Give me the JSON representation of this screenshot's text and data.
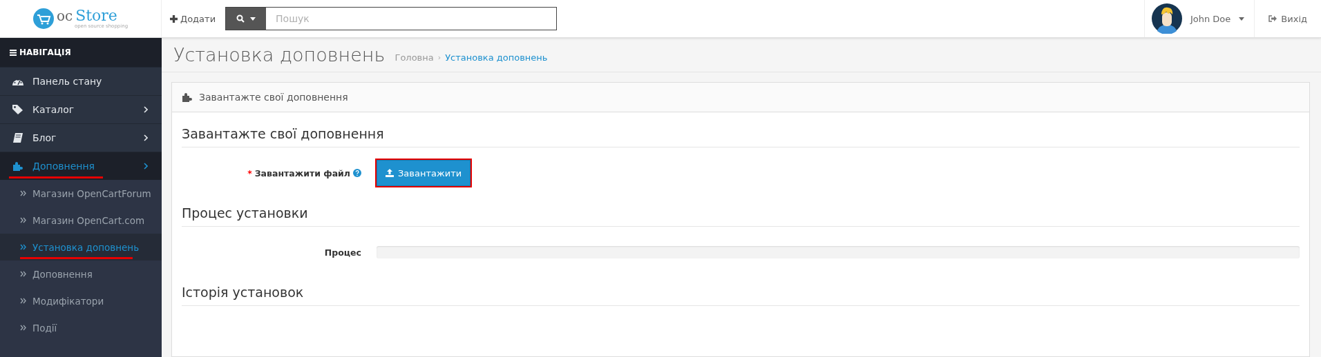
{
  "header": {
    "logo": {
      "word_1": "oc",
      "word_2": "Store",
      "tagline": "open source shopping"
    },
    "add_label": "Додати",
    "search": {
      "placeholder": "Пошук"
    },
    "user": {
      "name": "John Doe"
    },
    "logout": "Вихід"
  },
  "sidebar": {
    "title": "НАВІГАЦІЯ",
    "items": [
      {
        "label": "Панель стану",
        "kind": "dashboard",
        "expandable": false,
        "selected": false,
        "underlined": false
      },
      {
        "label": "Каталог",
        "kind": "tags",
        "expandable": true,
        "selected": false,
        "underlined": false
      },
      {
        "label": "Блог",
        "kind": "book",
        "expandable": true,
        "selected": false,
        "underlined": false
      },
      {
        "label": "Доповнення",
        "kind": "puzzle",
        "expandable": true,
        "selected": true,
        "underlined": true,
        "children": [
          {
            "label": "Магазин OpenCartForum",
            "selected": false,
            "underlined": false
          },
          {
            "label": "Магазин OpenCart.com",
            "selected": false,
            "underlined": false
          },
          {
            "label": "Установка доповнень",
            "selected": true,
            "underlined": true
          },
          {
            "label": "Доповнення",
            "selected": false,
            "underlined": false
          },
          {
            "label": "Модифікатори",
            "selected": false,
            "underlined": false
          },
          {
            "label": "Події",
            "selected": false,
            "underlined": false
          }
        ]
      }
    ]
  },
  "page": {
    "title": "Установка доповнень",
    "breadcrumbs": [
      {
        "label": "Головна",
        "selected": false
      },
      {
        "label": "Установка доповнень",
        "selected": true
      }
    ],
    "breadcrumb_separator": "›"
  },
  "panel": {
    "heading": "Завантажте свої доповнення",
    "sections": [
      {
        "legend": "Завантажте свої доповнення",
        "field": {
          "kind": "upload",
          "label": "Завантажити файл",
          "required_mark": "*",
          "help": true,
          "button": "Завантажити",
          "outlined": true
        }
      },
      {
        "legend": "Процес установки",
        "field": {
          "kind": "progress",
          "label": "Процес",
          "level": 0
        }
      },
      {
        "legend": "Історія установок"
      }
    ]
  }
}
